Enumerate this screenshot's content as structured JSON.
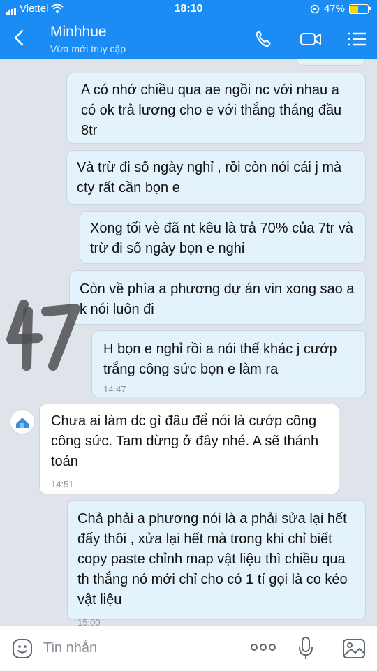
{
  "status_bar": {
    "carrier": "Viettel",
    "time": "18:10",
    "battery_percent": "47%"
  },
  "header": {
    "contact_name": "Minhhue",
    "contact_status": "Vừa mới truy cập",
    "icons": [
      "back-arrow-icon",
      "phone-icon",
      "video-call-icon",
      "menu-icon"
    ]
  },
  "messages": [
    {
      "from": "me",
      "text": "A có nhớ chiều qua ae ngồi nc với nhau a có ok trả lương cho e với thắng tháng đầu 8tr"
    },
    {
      "from": "me",
      "text": "Và trừ đi số ngày nghỉ , rồi còn nói cái j mà cty rất cần bọn e"
    },
    {
      "from": "me",
      "text": "Xong tối vè đã nt kêu là trả 70% của 7tr và trừ đi số ngày bọn e nghỉ"
    },
    {
      "from": "me",
      "text": "Còn về phía a phương dự án vin xong sao a k nói luôn đi"
    },
    {
      "from": "me",
      "text": "H bọn e nghỉ rồi a nói thế khác j cướp trắng công sức bọn e làm ra",
      "time": "14:47"
    },
    {
      "from": "them",
      "text": "Chưa ai làm dc gì đâu để nói là cướp công công sức. Tam dừng ở đây nhé. A sẽ thánh toán",
      "time": "14:51"
    },
    {
      "from": "me",
      "text": "Chả phải a phương nói là a phải sửa lại hết đấy thôi , xửa lại hết mà trong khi chỉ biết copy paste  chỉnh map vật liệu thì chiều qua th thắng nó mới chỉ cho có 1 tí gọi là co kéo vật liệu",
      "time": "15:00"
    }
  ],
  "input_bar": {
    "placeholder": "Tin nhắn",
    "icons": [
      "sticker-icon",
      "more-icon",
      "microphone-icon",
      "image-icon"
    ]
  },
  "colors": {
    "header_blue": "#1a8cf3",
    "chat_background": "#dfe3ea",
    "sent_bubble": "#e4f2fb",
    "received_bubble": "#ffffff",
    "battery_yellow": "#ffd400"
  }
}
